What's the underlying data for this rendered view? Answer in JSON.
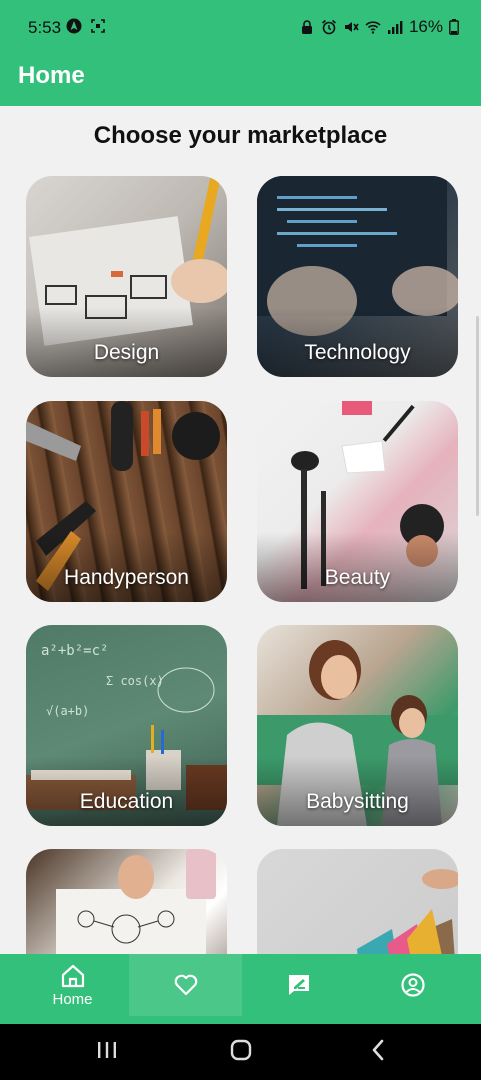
{
  "status_bar": {
    "time": "5:53",
    "battery": "16%"
  },
  "app_bar": {
    "title": "Home"
  },
  "main": {
    "heading": "Choose your marketplace",
    "categories": [
      {
        "label": "Design"
      },
      {
        "label": "Technology"
      },
      {
        "label": "Handyperson"
      },
      {
        "label": "Beauty"
      },
      {
        "label": "Education"
      },
      {
        "label": "Babysitting"
      },
      {
        "label": ""
      },
      {
        "label": ""
      }
    ]
  },
  "bottom_nav": {
    "items": [
      {
        "label": "Home",
        "icon": "home-icon"
      },
      {
        "label": "",
        "icon": "heart-icon"
      },
      {
        "label": "",
        "icon": "message-edit-icon"
      },
      {
        "label": "",
        "icon": "profile-icon"
      }
    ]
  },
  "colors": {
    "primary": "#33c07a",
    "background": "#f1f1f1"
  }
}
